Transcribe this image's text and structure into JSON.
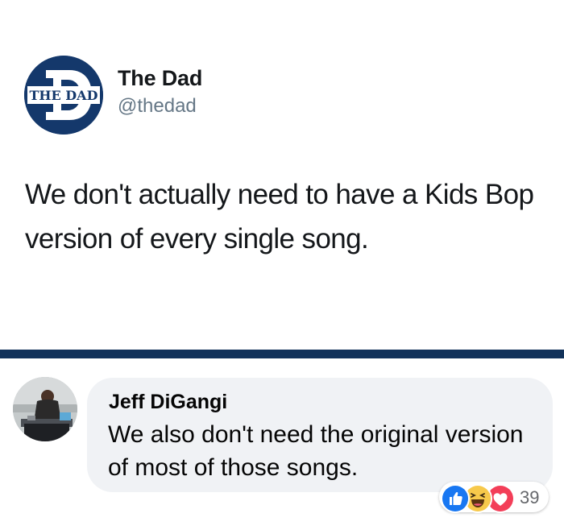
{
  "tweet": {
    "avatar_icon": "the-dad-logo",
    "avatar_text": "THE DAD",
    "name": "The Dad",
    "handle": "@thedad",
    "text": "We don't actually need to have a Kids Bop version of every single song."
  },
  "comment": {
    "avatar_icon": "person-at-dj-table-photo",
    "author": "Jeff DiGangi",
    "text": "We also don't need the original version of most of those songs.",
    "reactions": {
      "icons": [
        "like-icon",
        "haha-icon",
        "love-icon"
      ],
      "count": "39"
    }
  },
  "colors": {
    "brand_navy": "#14386b",
    "divider": "#12325a",
    "bubble": "#f0f2f5",
    "like_blue": "#1877f2",
    "haha_yellow": "#f7c94b",
    "love_red": "#f33e58"
  }
}
